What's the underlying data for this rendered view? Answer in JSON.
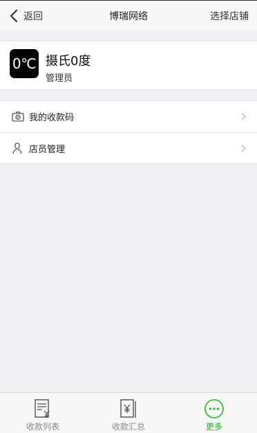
{
  "header": {
    "back_label": "返回",
    "title": "博瑞网络",
    "store_label": "选择店铺"
  },
  "profile": {
    "avatar_text": "0℃",
    "name": "摄氏0度",
    "role": "管理员"
  },
  "menu": {
    "items": [
      {
        "label": "我的收款码",
        "icon": "camera-icon"
      },
      {
        "label": "店员管理",
        "icon": "user-icon"
      }
    ]
  },
  "tabbar": {
    "tabs": [
      {
        "label": "收款列表",
        "icon": "receipt-list-icon",
        "active": false
      },
      {
        "label": "收款汇总",
        "icon": "receipt-summary-icon",
        "active": false
      },
      {
        "label": "更多",
        "icon": "more-icon",
        "active": true
      }
    ],
    "active_color": "#1fb922"
  }
}
